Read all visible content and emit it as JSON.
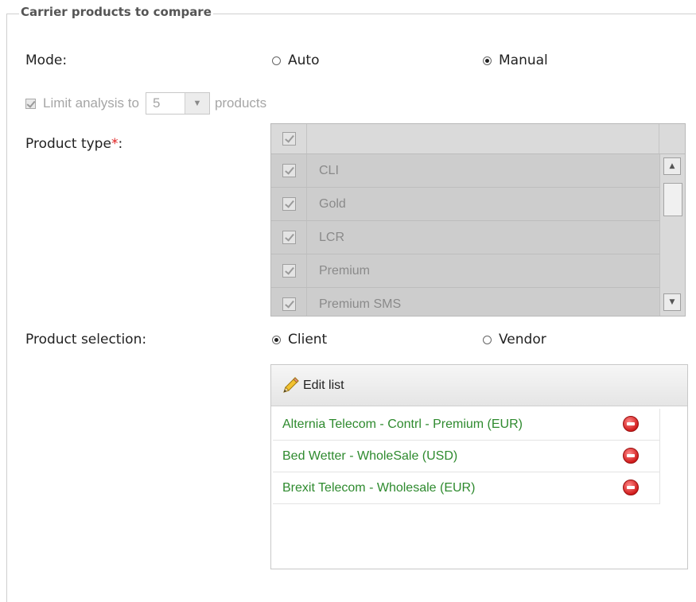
{
  "section": {
    "legend": "Carrier products to compare"
  },
  "mode": {
    "label": "Mode:",
    "options": [
      {
        "label": "Auto",
        "selected": false
      },
      {
        "label": "Manual",
        "selected": true
      }
    ]
  },
  "limit": {
    "checked": true,
    "disabled": true,
    "prefix": "Limit analysis to",
    "value": "5",
    "suffix": "products"
  },
  "product_type": {
    "label": "Product type",
    "required_mark": "*",
    "colon": ":",
    "items": [
      {
        "label": "CLI",
        "checked": true
      },
      {
        "label": "Gold",
        "checked": true
      },
      {
        "label": "LCR",
        "checked": true
      },
      {
        "label": "Premium",
        "checked": true
      },
      {
        "label": "Premium SMS",
        "checked": true
      }
    ]
  },
  "product_selection": {
    "label": "Product selection:",
    "options": [
      {
        "label": "Client",
        "selected": true
      },
      {
        "label": "Vendor",
        "selected": false
      }
    ],
    "edit_label": "Edit list",
    "items": [
      "Alternia Telecom - Contrl - Premium (EUR)",
      "Bed Wetter - WholeSale (USD)",
      "Brexit Telecom - Wholesale (EUR)"
    ]
  },
  "colors": {
    "product_link": "#2e8a2e",
    "required": "#e02020",
    "remove": "#d11c1c"
  },
  "icons": {
    "edit": "pencil-icon",
    "remove": "remove-circle-icon",
    "dropdown": "chevron-down-icon"
  }
}
